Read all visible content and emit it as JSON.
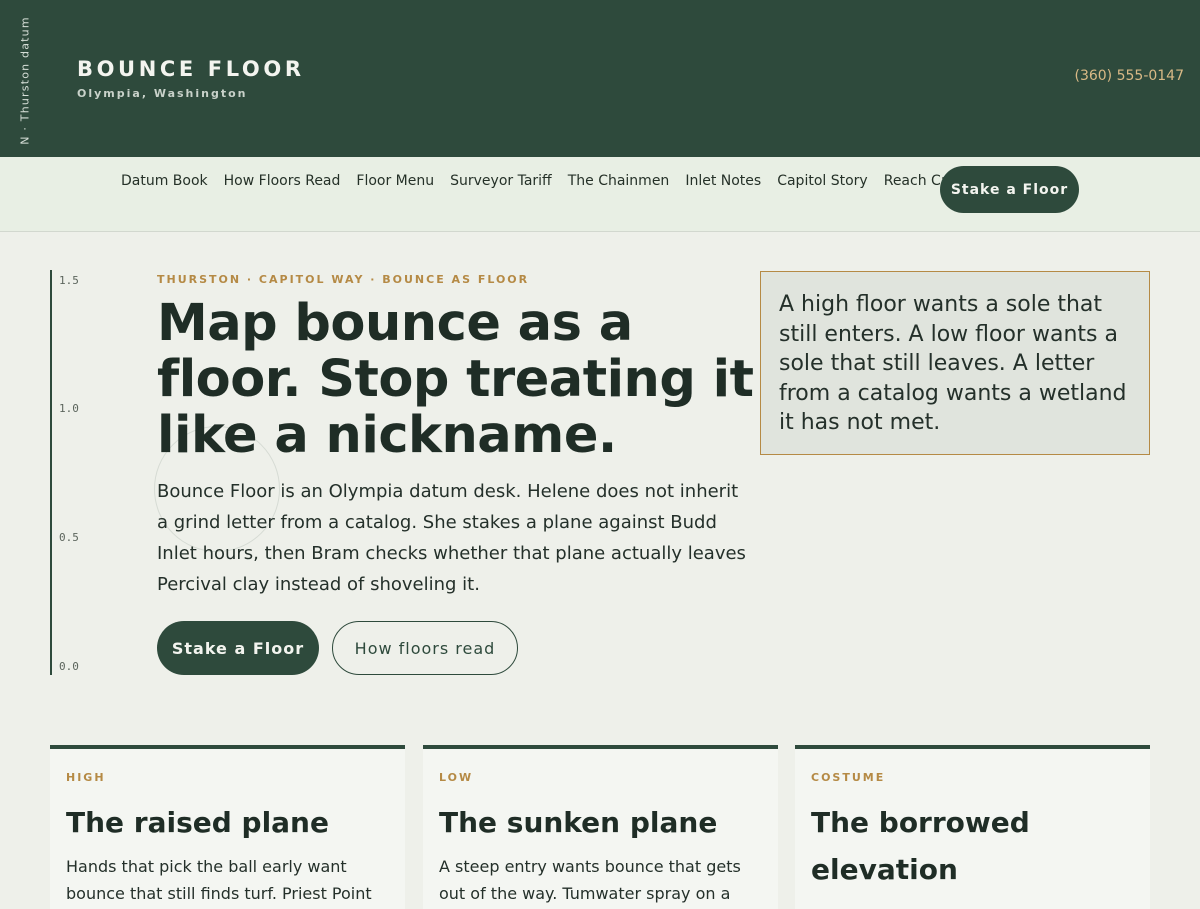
{
  "header": {
    "vertical_label": "N · Thurston datum",
    "brand_name": "BOUNCE FLOOR",
    "brand_location": "Olympia, Washington",
    "phone": "(360) 555-0147"
  },
  "nav": {
    "items": [
      {
        "label": "Datum Book"
      },
      {
        "label": "How Floors Read"
      },
      {
        "label": "Floor Menu"
      },
      {
        "label": "Surveyor Tariff"
      },
      {
        "label": "The Chainmen"
      },
      {
        "label": "Inlet Notes"
      },
      {
        "label": "Capitol Story"
      },
      {
        "label": "Reach Capitol"
      }
    ],
    "cta": "Stake a Floor"
  },
  "scale": {
    "ticks": [
      "1.5",
      "1.0",
      "0.5",
      "0.0"
    ]
  },
  "hero": {
    "eyebrow": "THURSTON · CAPITOL WAY · BOUNCE AS FLOOR",
    "headline": "Map bounce as a floor. Stop treating it like a nickname.",
    "lead": "Bounce Floor is an Olympia datum desk. Helene does not inherit a grind letter from a catalog. She stakes a plane against Budd Inlet hours, then Bram checks whether that plane actually leaves Percival clay instead of shoveling it.",
    "primary_button": "Stake a Floor",
    "secondary_button": "How floors read",
    "quote": "A high floor wants a sole that still enters. A low floor wants a sole that still leaves. A letter from a catalog wants a wetland it has not met."
  },
  "cards": [
    {
      "tag": "HIGH",
      "title": "The raised plane",
      "body": "Hands that pick the ball early want bounce that still finds turf. Priest Point"
    },
    {
      "tag": "LOW",
      "title": "The sunken plane",
      "body": "A steep entry wants bounce that gets out of the way. Tumwater spray on a"
    },
    {
      "tag": "COSTUME",
      "title": "The borrowed elevation",
      "body": ""
    }
  ],
  "colors": {
    "header_bg": "#2e4a3c",
    "accent_gold": "#b58a45",
    "page_bg": "#eef0ea"
  }
}
